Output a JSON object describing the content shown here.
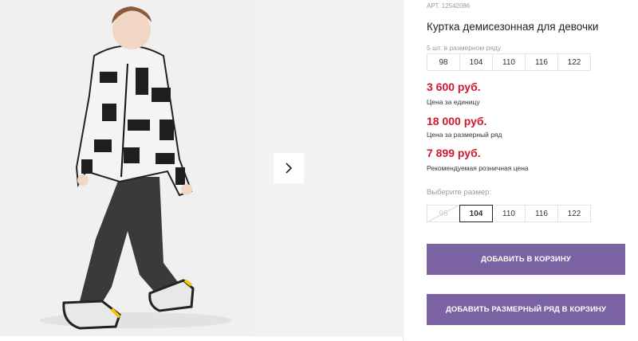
{
  "product": {
    "article": "АРТ. 12542086",
    "title": "Куртка демисезонная для девочки",
    "pack_label": "5 шт. в размерном ряду",
    "pack_sizes": [
      "98",
      "104",
      "110",
      "116",
      "122"
    ]
  },
  "prices": [
    {
      "value": "3 600 руб.",
      "label": "Цена за единицу"
    },
    {
      "value": "18 000 руб.",
      "label": "Цена за размерный ряд"
    },
    {
      "value": "7 899 руб.",
      "label": "Рекомендуемая розничная цена"
    }
  ],
  "size_picker": {
    "label": "Выберите размер:",
    "options": [
      {
        "size": "98",
        "state": "disabled"
      },
      {
        "size": "104",
        "state": "selected"
      },
      {
        "size": "110",
        "state": "available"
      },
      {
        "size": "116",
        "state": "available"
      },
      {
        "size": "122",
        "state": "available"
      }
    ]
  },
  "buttons": {
    "add_to_cart": "ДОБАВИТЬ В КОРЗИНУ",
    "add_size_row": "ДОБАВИТЬ РАЗМЕРНЫЙ РЯД В КОРЗИНУ"
  },
  "gallery": {
    "next_icon": "chevron-right-icon"
  },
  "colors": {
    "price": "#d0182e",
    "button": "#7b62a3",
    "photo_background": "#f0f0f0"
  }
}
